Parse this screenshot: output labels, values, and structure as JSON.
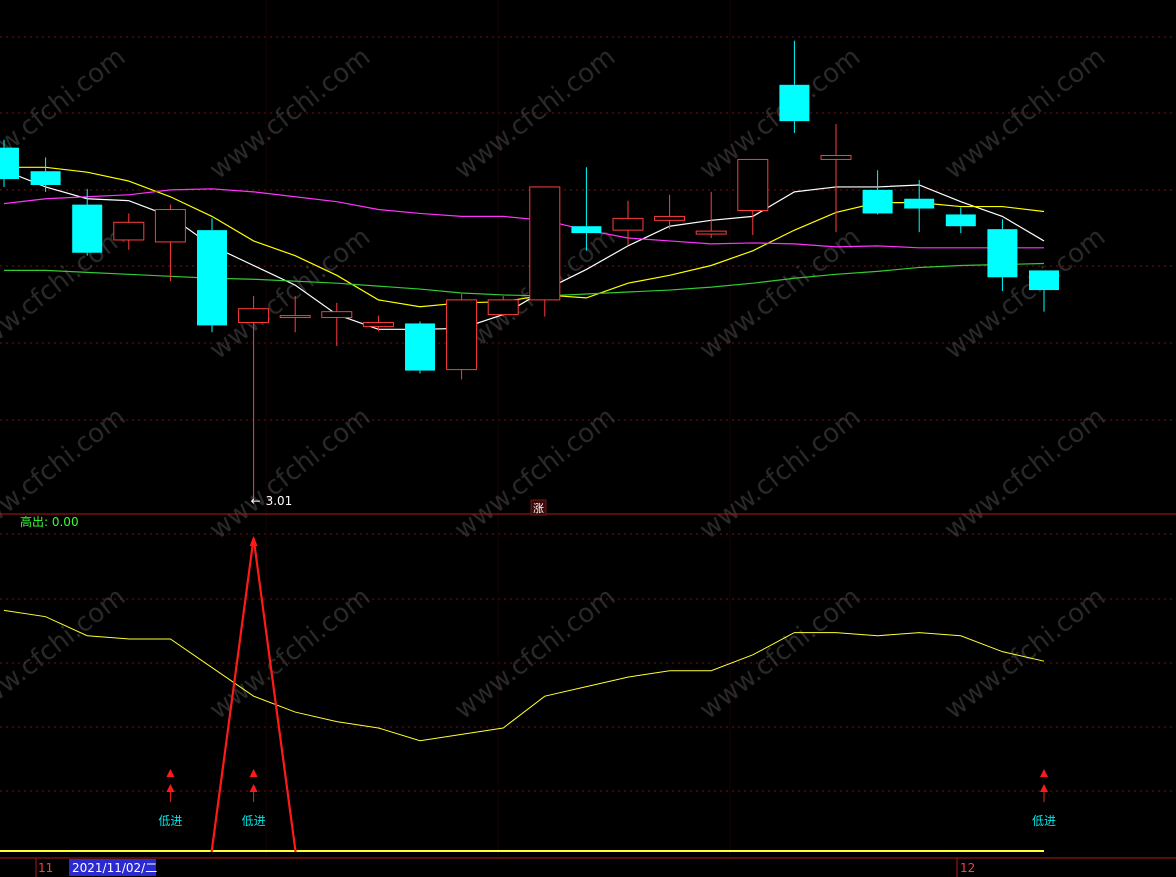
{
  "colors": {
    "background": "#000000",
    "up_candle": "#ff3c3c",
    "down_candle": "#00ffff",
    "ma_fast": "#ffffff",
    "ma_mid": "#ffff00",
    "ma_slow": "#ff33ff",
    "ma_long": "#33cc33",
    "indicator_line": "#ffff33",
    "signal": "#ff1a1a",
    "grid": "#7a1010",
    "divider": "#b01818",
    "label_cyan": "#00e5e5",
    "label_green": "#33ff33"
  },
  "watermark": "www.cfchi.com",
  "price_panel": {
    "min_label": "3.01",
    "badge": "涨"
  },
  "indicator_panel": {
    "readout": "高出: 0.00",
    "signal_label": "低进"
  },
  "date_axis": {
    "left_month": "11",
    "selected_date": "2021/11/02/二",
    "right_month": "12"
  },
  "chart_data": [
    {
      "type": "candlestick",
      "candles": [
        {
          "o": 3.37,
          "c": 3.338,
          "h": 3.378,
          "l": 3.33
        },
        {
          "o": 3.346,
          "c": 3.332,
          "h": 3.36,
          "l": 3.325
        },
        {
          "o": 3.312,
          "c": 3.263,
          "h": 3.328,
          "l": 3.26
        },
        {
          "o": 3.276,
          "c": 3.294,
          "h": 3.303,
          "l": 3.266
        },
        {
          "o": 3.274,
          "c": 3.307,
          "h": 3.312,
          "l": 3.234
        },
        {
          "o": 3.286,
          "c": 3.189,
          "h": 3.298,
          "l": 3.182
        },
        {
          "o": 3.192,
          "c": 3.206,
          "h": 3.219,
          "l": 3.01
        },
        {
          "o": 3.197,
          "c": 3.199,
          "h": 3.219,
          "l": 3.182
        },
        {
          "o": 3.197,
          "c": 3.203,
          "h": 3.212,
          "l": 3.168
        },
        {
          "o": 3.188,
          "c": 3.192,
          "h": 3.199,
          "l": 3.183
        },
        {
          "o": 3.191,
          "c": 3.143,
          "h": 3.193,
          "l": 3.14
        },
        {
          "o": 3.144,
          "c": 3.215,
          "h": 3.221,
          "l": 3.134
        },
        {
          "o": 3.2,
          "c": 3.215,
          "h": 3.219,
          "l": 3.198
        },
        {
          "o": 3.215,
          "c": 3.33,
          "h": 3.33,
          "l": 3.198
        },
        {
          "o": 3.29,
          "c": 3.283,
          "h": 3.35,
          "l": 3.265
        },
        {
          "o": 3.286,
          "c": 3.298,
          "h": 3.316,
          "l": 3.271
        },
        {
          "o": 3.296,
          "c": 3.3,
          "h": 3.322,
          "l": 3.287
        },
        {
          "o": 3.282,
          "c": 3.285,
          "h": 3.325,
          "l": 3.278
        },
        {
          "o": 3.306,
          "c": 3.358,
          "h": 3.358,
          "l": 3.281
        },
        {
          "o": 3.434,
          "c": 3.397,
          "h": 3.479,
          "l": 3.385
        },
        {
          "o": 3.358,
          "c": 3.362,
          "h": 3.394,
          "l": 3.284
        },
        {
          "o": 3.327,
          "c": 3.303,
          "h": 3.347,
          "l": 3.302
        },
        {
          "o": 3.318,
          "c": 3.308,
          "h": 3.337,
          "l": 3.284
        },
        {
          "o": 3.302,
          "c": 3.29,
          "h": 3.309,
          "l": 3.283
        },
        {
          "o": 3.287,
          "c": 3.238,
          "h": 3.297,
          "l": 3.224
        },
        {
          "o": 3.245,
          "c": 3.225,
          "h": 3.245,
          "l": 3.203
        }
      ],
      "moving_averages": [
        {
          "name": "ma_fast",
          "values": [
            3.347,
            3.33,
            3.318,
            3.316,
            3.3,
            3.27,
            3.25,
            3.23,
            3.2,
            3.185,
            3.185,
            3.186,
            3.2,
            3.225,
            3.246,
            3.27,
            3.29,
            3.296,
            3.3,
            3.325,
            3.33,
            3.33,
            3.332,
            3.315,
            3.3,
            3.275
          ]
        },
        {
          "name": "ma_mid",
          "values": [
            3.35,
            3.35,
            3.345,
            3.336,
            3.32,
            3.3,
            3.275,
            3.26,
            3.24,
            3.215,
            3.208,
            3.212,
            3.213,
            3.22,
            3.217,
            3.232,
            3.24,
            3.25,
            3.265,
            3.286,
            3.304,
            3.314,
            3.314,
            3.31,
            3.31,
            3.305
          ]
        },
        {
          "name": "ma_slow",
          "values": [
            3.313,
            3.318,
            3.32,
            3.322,
            3.327,
            3.328,
            3.325,
            3.32,
            3.315,
            3.307,
            3.303,
            3.3,
            3.3,
            3.296,
            3.286,
            3.278,
            3.275,
            3.272,
            3.273,
            3.272,
            3.269,
            3.27,
            3.268,
            3.268,
            3.268,
            3.268
          ]
        },
        {
          "name": "ma_long",
          "values": [
            3.245,
            3.245,
            3.243,
            3.241,
            3.239,
            3.237,
            3.236,
            3.234,
            3.232,
            3.229,
            3.226,
            3.222,
            3.22,
            3.219,
            3.221,
            3.223,
            3.225,
            3.228,
            3.232,
            3.237,
            3.241,
            3.244,
            3.248,
            3.25,
            3.251,
            3.252
          ]
        }
      ]
    },
    {
      "type": "line",
      "series": [
        {
          "values": [
            76,
            74,
            68,
            67,
            67,
            58,
            49,
            44,
            41,
            39,
            35,
            37,
            39,
            49,
            52,
            55,
            57,
            57,
            62,
            69,
            69,
            68,
            69,
            68,
            63,
            60
          ]
        }
      ],
      "signal_spike_index": 6,
      "signal_markers": [
        4,
        6,
        25
      ]
    }
  ]
}
